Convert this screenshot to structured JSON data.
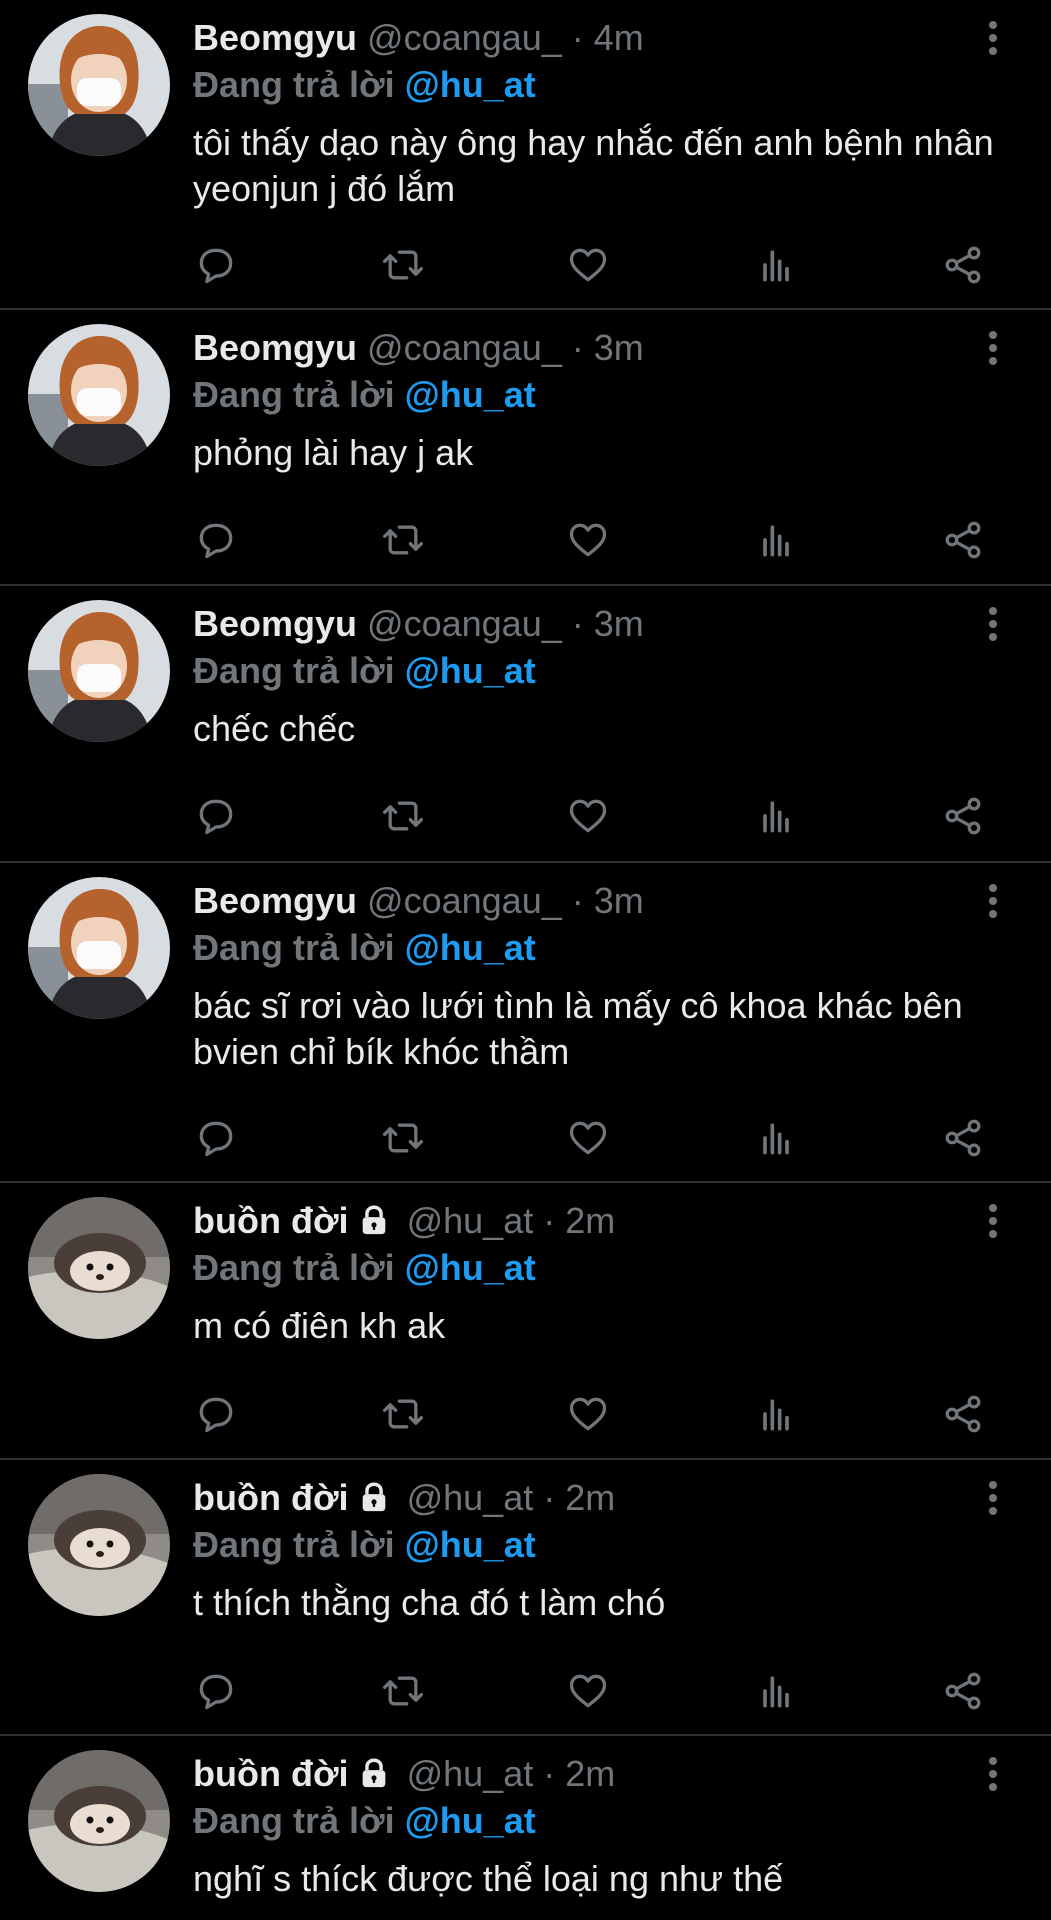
{
  "colors": {
    "background": "#000000",
    "text": "#e7e9ea",
    "secondary": "#71767b",
    "accent": "#1d9bf0",
    "divider": "#2f3336"
  },
  "tweets": [
    {
      "display_name": "Beomgyu",
      "handle": "@coangau_",
      "separator": "·",
      "time": "4m",
      "reply_prefix": "Đang trả lời",
      "reply_to": "@hu_at",
      "text": "tôi thấy dạo này ông hay nhắc đến anh bệnh nhân yeonjun j đó lắm",
      "locked": false,
      "avatar": "boy-with-mask-avatar"
    },
    {
      "display_name": "Beomgyu",
      "handle": "@coangau_",
      "separator": "·",
      "time": "3m",
      "reply_prefix": "Đang trả lời",
      "reply_to": "@hu_at",
      "text": "phỏng lài hay j ak",
      "locked": false,
      "avatar": "boy-with-mask-avatar"
    },
    {
      "display_name": "Beomgyu",
      "handle": "@coangau_",
      "separator": "·",
      "time": "3m",
      "reply_prefix": "Đang trả lời",
      "reply_to": "@hu_at",
      "text": "chếc chếc",
      "locked": false,
      "avatar": "boy-with-mask-avatar"
    },
    {
      "display_name": "Beomgyu",
      "handle": "@coangau_",
      "separator": "·",
      "time": "3m",
      "reply_prefix": "Đang trả lời",
      "reply_to": "@hu_at",
      "text": "bác sĩ rơi vào lưới tình là mấy cô khoa khác bên bvien chỉ bík khóc thầm",
      "locked": false,
      "avatar": "boy-with-mask-avatar"
    },
    {
      "display_name": "buồn đời",
      "handle": "@hu_at",
      "separator": "·",
      "time": "2m",
      "reply_prefix": "Đang trả lời",
      "reply_to": "@hu_at",
      "text": "m có điên kh ak",
      "locked": true,
      "avatar": "hedgehog-avatar"
    },
    {
      "display_name": "buồn đời",
      "handle": "@hu_at",
      "separator": "·",
      "time": "2m",
      "reply_prefix": "Đang trả lời",
      "reply_to": "@hu_at",
      "text": "t thích thằng cha đó t làm chó",
      "locked": true,
      "avatar": "hedgehog-avatar"
    },
    {
      "display_name": "buồn đời",
      "handle": "@hu_at",
      "separator": "·",
      "time": "2m",
      "reply_prefix": "Đang trả lời",
      "reply_to": "@hu_at",
      "text": "nghĩ s thíck được thể loại ng như thế",
      "locked": true,
      "avatar": "hedgehog-avatar"
    }
  ],
  "action_icons": [
    "reply-icon",
    "retweet-icon",
    "like-icon",
    "views-icon",
    "share-icon"
  ]
}
